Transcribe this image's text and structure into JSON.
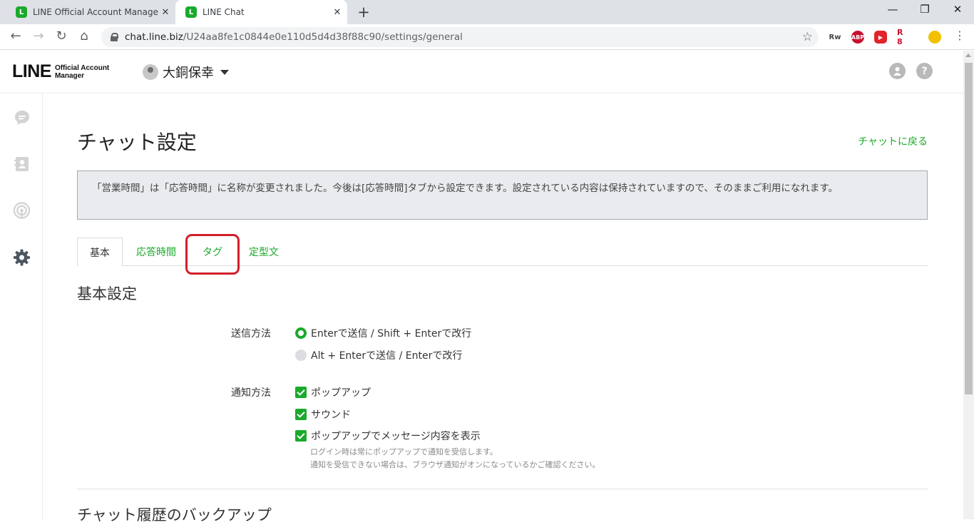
{
  "browser": {
    "tabs": [
      {
        "title": "LINE Official Account Manager",
        "active": false
      },
      {
        "title": "LINE Chat",
        "active": true
      }
    ],
    "url_host": "chat.line.biz",
    "url_path": "/U24aa8fe1c0844e0e110d5d4d38f88c90/settings/general",
    "ext_labels": [
      "Rw",
      "ABP",
      "▶",
      "R 8"
    ]
  },
  "header": {
    "logo_main": "LINE",
    "logo_sub_1": "Official Account",
    "logo_sub_2": "Manager",
    "account_name": "大銅保幸"
  },
  "page": {
    "title": "チャット設定",
    "back_link": "チャットに戻る",
    "notice": "「営業時間」は「応答時間」に名称が変更されました。今後は[応答時間]タブから設定できます。設定されている内容は保持されていますので、そのままご利用になれます。",
    "tabs": [
      "基本",
      "応答時間",
      "タグ",
      "定型文"
    ]
  },
  "basic": {
    "section_title": "基本設定",
    "send_label": "送信方法",
    "send_options": [
      "Enterで送信 / Shift + Enterで改行",
      "Alt + Enterで送信 / Enterで改行"
    ],
    "notify_label": "通知方法",
    "notify_options": [
      "ポップアップ",
      "サウンド",
      "ポップアップでメッセージ内容を表示"
    ],
    "hint_1": "ログイン時は常にポップアップで通知を受信します。",
    "hint_2": "通知を受信できない場合は、ブラウザ通知がオンになっているかご確認ください。"
  },
  "backup": {
    "section_title": "チャット履歴のバックアップ"
  },
  "colors": {
    "accent": "#1aaa2b",
    "highlight": "#d21f2a"
  }
}
